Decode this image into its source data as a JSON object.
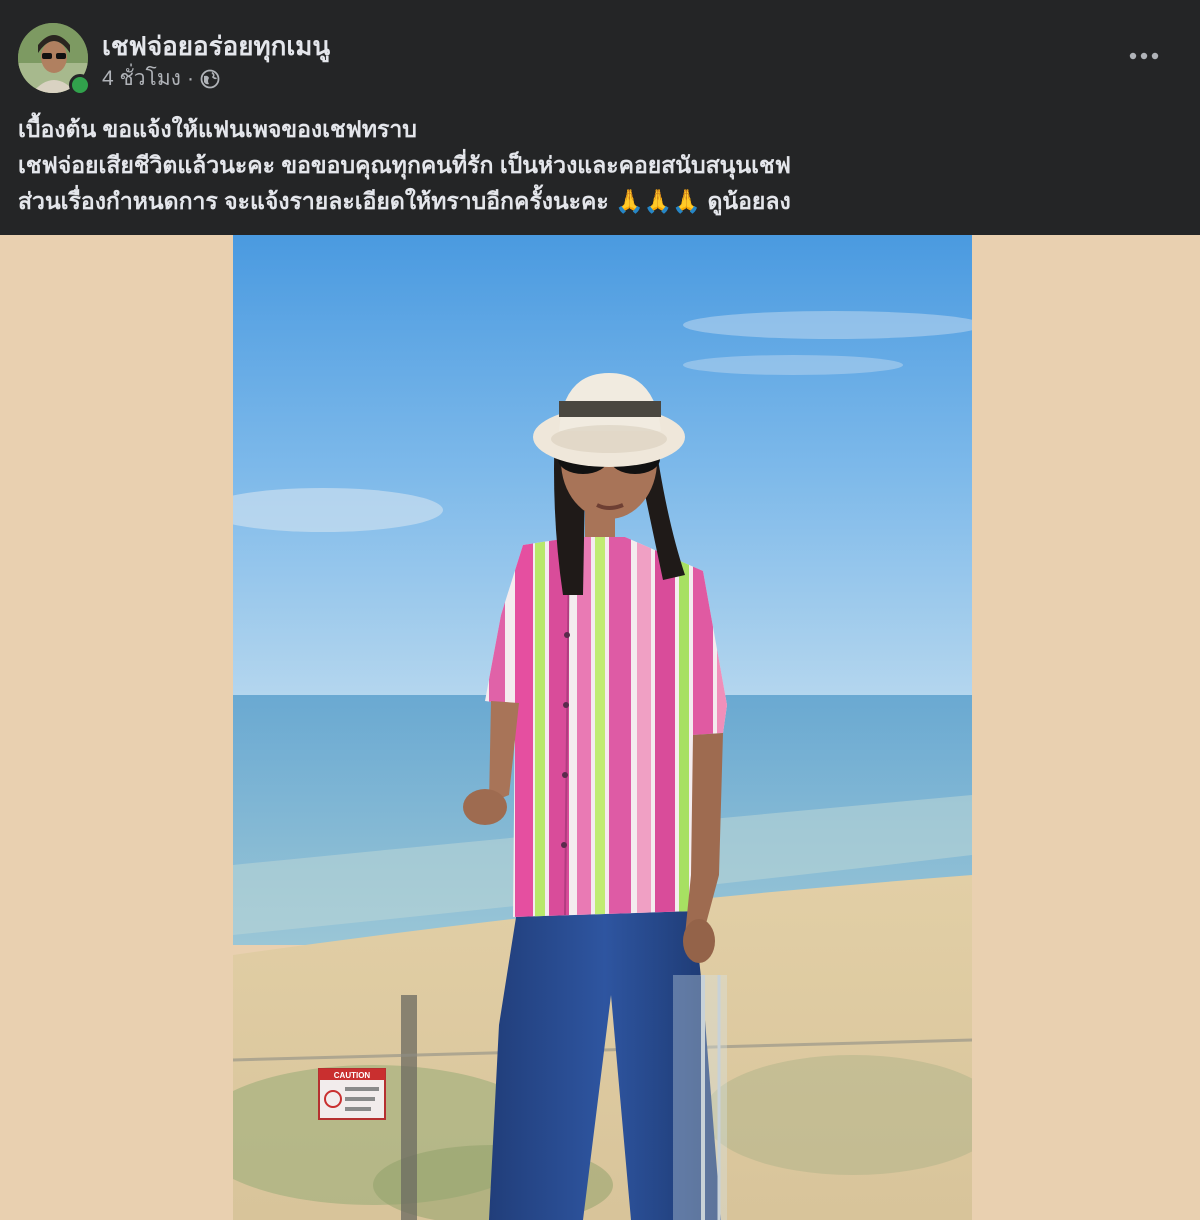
{
  "post": {
    "page_name": "เชฟจ่อยอร่อยทุกเมนู",
    "time": "4 ชั่วโมง",
    "separator": "·",
    "privacy_icon": "globe-icon",
    "more_icon": "more-options-icon",
    "online": true,
    "lines": [
      "เบื้องต้น ขอแจ้งให้แฟนเพจของเชฟทราบ",
      "เชฟจ่อยเสียชีวิตแล้วนะคะ ขอขอบคุณทุกคนที่รัก เป็นห่วงและคอยสนับสนุนเชฟ",
      "ส่วนเรื่องกำหนดการ จะแจ้งรายละเอียดให้ทราบอีกครั้งนะคะ 🙏🙏🙏 ดูน้อยลง"
    ]
  },
  "colors": {
    "header_bg": "#242526",
    "photo_side_bg": "#e9d0b0",
    "online": "#31a24c"
  },
  "photo": {
    "sign_text": "CAUTION"
  }
}
